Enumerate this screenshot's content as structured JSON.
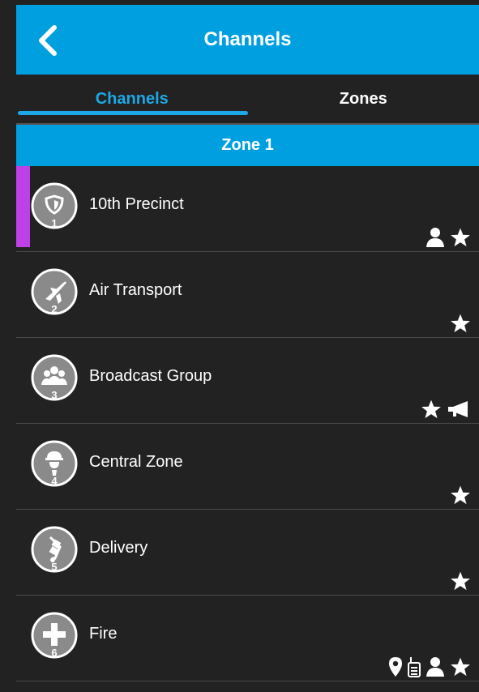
{
  "header": {
    "title": "Channels"
  },
  "tabs": [
    {
      "label": "Channels",
      "active": true
    },
    {
      "label": "Zones",
      "active": false
    }
  ],
  "zone": {
    "label": "Zone 1"
  },
  "colors": {
    "accent": "#00a0e0",
    "selected": "#c040e8",
    "background": "#222222"
  },
  "channels": [
    {
      "name": "10th Precinct",
      "number": "1",
      "icon": "shield-icon",
      "selected": true,
      "badges": [
        "person-icon",
        "star-icon"
      ]
    },
    {
      "name": "Air Transport",
      "number": "2",
      "icon": "airplane-icon",
      "selected": false,
      "badges": [
        "star-icon"
      ]
    },
    {
      "name": "Broadcast Group",
      "number": "3",
      "icon": "group-icon",
      "selected": false,
      "badges": [
        "star-icon",
        "megaphone-icon"
      ]
    },
    {
      "name": "Central Zone",
      "number": "4",
      "icon": "hardhat-worker-icon",
      "selected": false,
      "badges": [
        "star-icon"
      ]
    },
    {
      "name": "Delivery",
      "number": "5",
      "icon": "hand-truck-icon",
      "selected": false,
      "badges": [
        "star-icon"
      ]
    },
    {
      "name": "Fire",
      "number": "6",
      "icon": "medical-cross-icon",
      "selected": false,
      "badges": [
        "location-pin-icon",
        "radio-icon",
        "person-icon",
        "star-icon"
      ]
    }
  ]
}
